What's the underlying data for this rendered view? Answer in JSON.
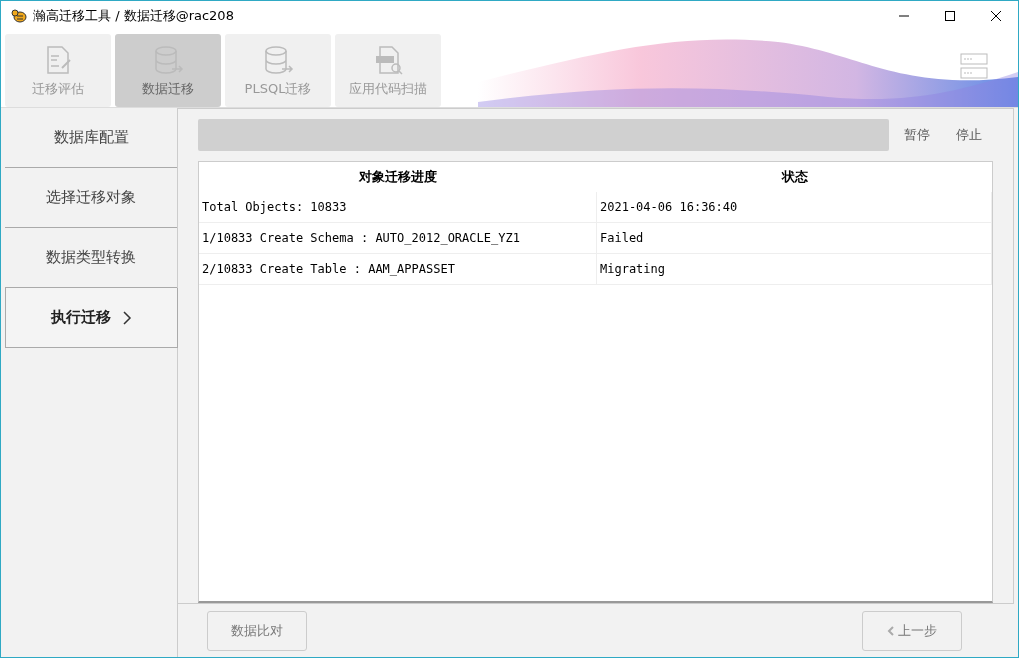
{
  "window": {
    "title": "瀚高迁移工具 / 数据迁移@rac208"
  },
  "tabs": [
    {
      "label": "迁移评估",
      "kind": "document",
      "selected": false
    },
    {
      "label": "数据迁移",
      "kind": "database",
      "selected": true
    },
    {
      "label": "PLSQL迁移",
      "kind": "database",
      "selected": false
    },
    {
      "label": "应用代码扫描",
      "kind": "scan",
      "selected": false
    }
  ],
  "sidebar": {
    "items": [
      {
        "label": "数据库配置",
        "selected": false
      },
      {
        "label": "选择迁移对象",
        "selected": false
      },
      {
        "label": "数据类型转换",
        "selected": false
      },
      {
        "label": "执行迁移",
        "selected": true
      }
    ]
  },
  "progress": {
    "level": 0
  },
  "actions": [
    "暂停",
    "停止"
  ],
  "table": {
    "columns": [
      "对象迁移进度",
      "状态"
    ],
    "rows": [
      [
        "Total Objects: 10833",
        "2021-04-06 16:36:40"
      ],
      [
        "1/10833 Create Schema : AUTO_2012_ORACLE_YZ1",
        "Failed"
      ],
      [
        "2/10833 Create Table : AAM_APPASSET",
        "Migrating"
      ]
    ]
  },
  "footer": {
    "left_button": "数据比对",
    "right_button": "上一步"
  }
}
